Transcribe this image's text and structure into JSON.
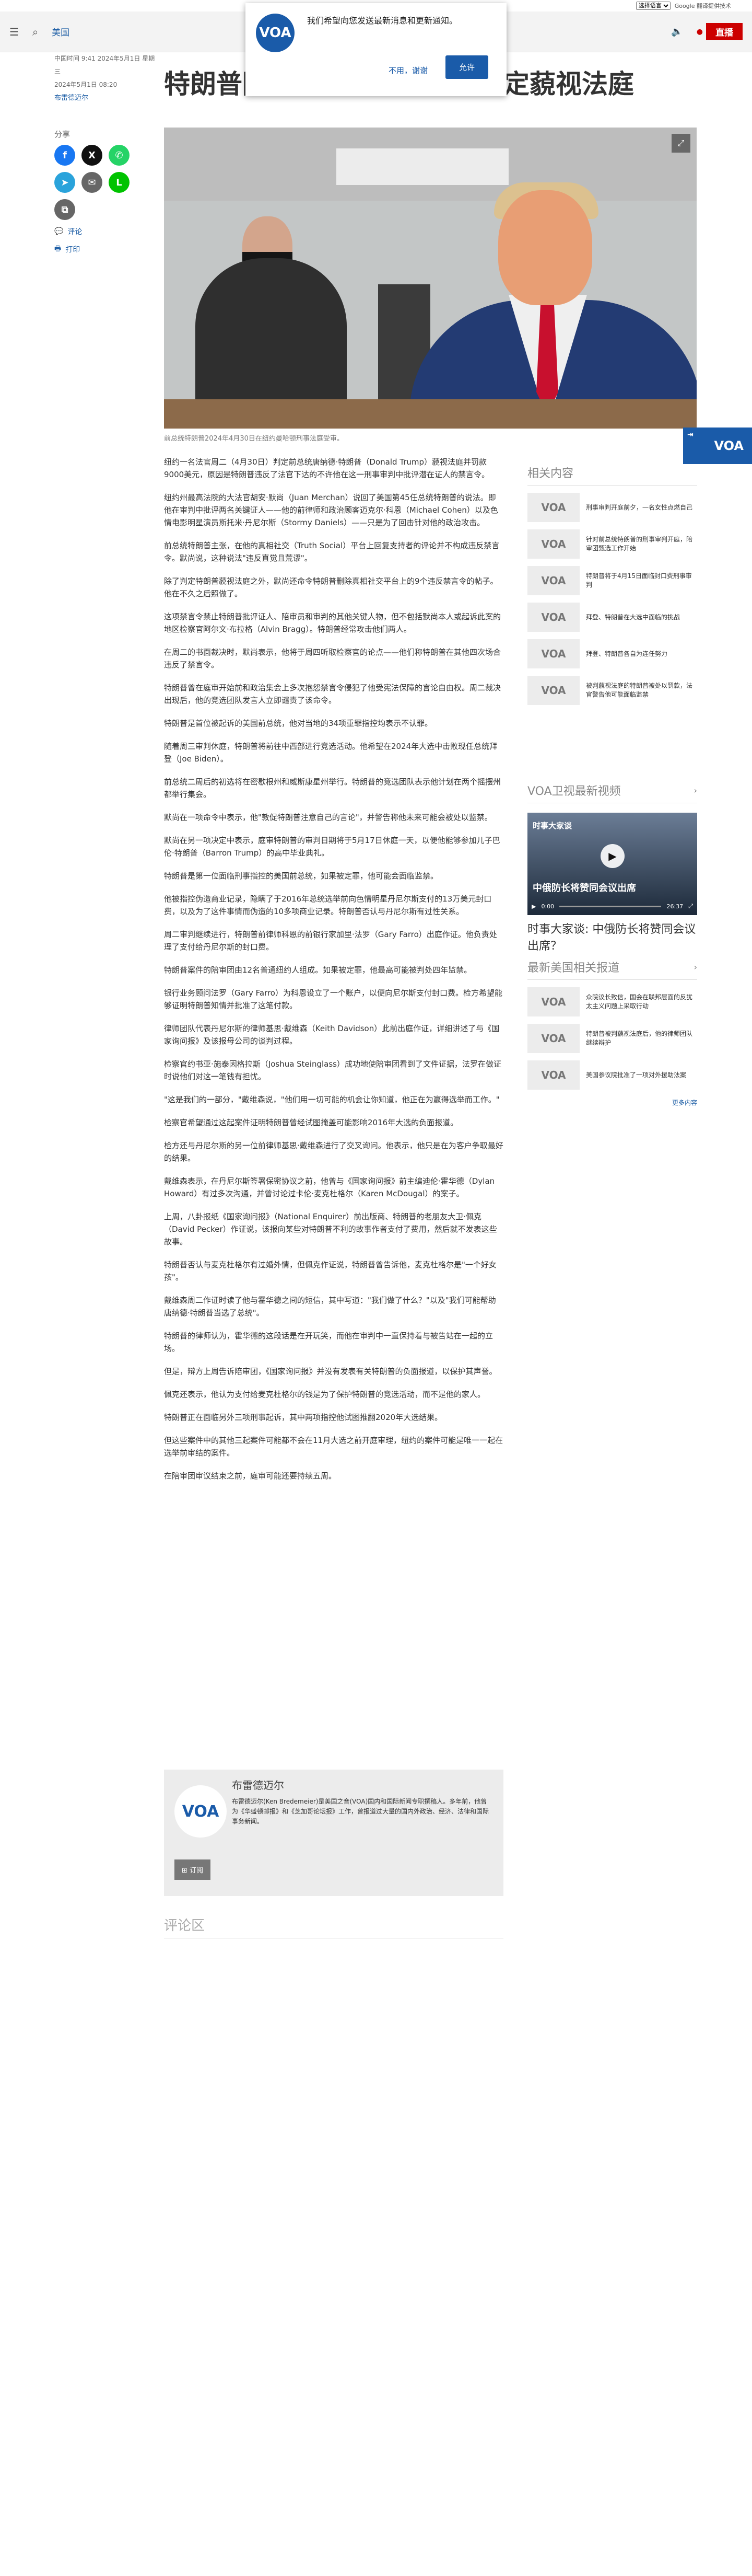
{
  "topbar": {
    "language": "选择语言",
    "translate": "Google 翻译提供技术"
  },
  "header": {
    "site": "美国",
    "live_label": "直播",
    "live_dot": "●"
  },
  "popup": {
    "logo": "VOA",
    "message": "我们希望向您发送最新消息和更新通知。",
    "deny": "不用，谢谢",
    "allow": "允许"
  },
  "meta": {
    "updated": "中国时间 9:41 2024年5月1日 星期三",
    "published": "2024年5月1日 08:20",
    "author": "布雷德迈尔"
  },
  "share": {
    "label": "分享",
    "comments": "评论",
    "print": "打印"
  },
  "article": {
    "title": "特朗普因违反禁言令被法官判定藐视法庭",
    "caption": "前总统特朗普2024年4月30日在纽约曼哈顿刑事法庭受审。",
    "paragraphs": [
      "纽约一名法官周二（4月30日）判定前总统唐纳德·特朗普（Donald Trump）藐视法庭并罚款9000美元，原因是特朗普违反了法官下达的不许他在这一刑事审判中批评潜在证人的禁言令。",
      "纽约州最高法院的大法官胡安·默尚（Juan Merchan）说回了美国第45任总统特朗普的说法。即他在审判中批评两名关键证人——他的前律师和政治顾客迈克尔·科恩（Michael Cohen）以及色情电影明星演员斯托米·丹尼尔斯（Stormy Daniels）——只是为了回击针对他的政治攻击。",
      "前总统特朗普主张，在他的真相社交（Truth Social）平台上回复支持者的评论并不构成违反禁言令。默尚说，这种说法\"违反直觉且荒谬\"。",
      "除了判定特朗普藐视法庭之外，默尚还命令特朗普删除真相社交平台上的9个违反禁言令的帖子。他在不久之后照做了。",
      "这项禁言令禁止特朗普批评证人、陪审员和审判的其他关键人物，但不包括默尚本人或起诉此案的地区检察官阿尔文·布拉格（Alvin Bragg）。特朗普经常攻击他们两人。",
      "在周二的书面裁决时，默尚表示，他将于周四听取检察官的论点——他们称特朗普在其他四次场合违反了禁言令。",
      "特朗普曾在庭审开始前和政治集会上多次抱怨禁言令侵犯了他受宪法保障的言论自由权。周二裁决出现后，他的竞选团队发言人立即谴责了该命令。",
      "特朗普是首位被起诉的美国前总统，他对当地的34项重罪指控均表示不认罪。",
      "随着周三审判休庭，特朗普将前往中西部进行竞选活动。他希望在2024年大选中击败现任总统拜登（Joe Biden）。",
      "前总统二周后的初选将在密歇根州和威斯康星州举行。特朗普的竞选团队表示他计划在两个摇摆州都举行集会。",
      "默尚在一项命令中表示，他\"敦促特朗普注意自己的言论\"，并警告称他未来可能会被处以监禁。",
      "默尚在另一项决定中表示，庭审特朗普的审判日期将于5月17日休庭一天，以便他能够参加儿子巴伦·特朗普（Barron Trump）的高中毕业典礼。",
      "特朗普是第一位面临刑事指控的美国前总统，如果被定罪，他可能会面临监禁。",
      "他被指控伪造商业记录，隐瞒了于2016年总统选举前向色情明星丹尼尔斯支付的13万美元封口费，以及为了这件事情而伪造的10多项商业记录。特朗普否认与丹尼尔斯有过性关系。",
      "周二审判继续进行，特朗普前律师科恩的前银行家加里·法罗（Gary Farro）出庭作证。他负责处理了支付给丹尼尔斯的封口费。",
      "特朗普案件的陪审团由12名普通纽约人组成。如果被定罪，他最高可能被判处四年监禁。",
      "银行业务顾问法罗（Gary Farro）为科恩设立了一个账户，以便向尼尔斯支付封口费。检方希望能够证明特朗普知情并批准了这笔付款。",
      "律师团队代表丹尼尔斯的律师基思·戴维森（Keith Davidson）此前出庭作证，详细讲述了与《国家询问报》及该报母公司的谈判过程。",
      "检察官约书亚·施泰因格拉斯（Joshua Steinglass）成功地使陪审团看到了文件证据，法罗在做证时说他们对这一笔钱有担忧。",
      "\"这是我们的一部分，\"戴维森说，\"他们用一切可能的机会让你知道，他正在为赢得选举而工作。\"",
      "检察官希望通过这起案件证明特朗普曾经试图掩盖可能影响2016年大选的负面报道。",
      "检方还与丹尼尔斯的另一位前律师基思·戴维森进行了交叉询问。他表示，他只是在为客户争取最好的结果。",
      "戴维森表示，在丹尼尔斯签署保密协议之前，他曾与《国家询问报》前主编迪伦·霍华德（Dylan Howard）有过多次沟通，并曾讨论过卡伦·麦克杜格尔（Karen McDougal）的案子。",
      "上周，八卦报纸《国家询问报》（National Enquirer）前出版商、特朗普的老朋友大卫·佩克（David Pecker）作证说，该报向某些对特朗普不利的故事作者支付了费用，然后就不发表这些故事。",
      "特朗普否认与麦克杜格尔有过婚外情，但佩克作证说，特朗普曾告诉他，麦克杜格尔是\"一个好女孩\"。",
      "戴维森周二作证时读了他与霍华德之间的短信，其中写道：\"我们做了什么？\"以及\"我们可能帮助唐纳德·特朗普当选了总统\"。",
      "特朗普的律师认为，霍华德的这段话是在开玩笑，而他在审判中一直保持着与被告站在一起的立场。",
      "但是，辩方上周告诉陪审团，《国家询问报》并没有发表有关特朗普的负面报道，以保护其声誉。",
      "佩克还表示，他认为支付给麦克杜格尔的钱是为了保护特朗普的竞选活动，而不是他的家人。",
      "特朗普正在面临另外三项刑事起诉，其中两项指控他试图推翻2020年大选结果。",
      "但这些案件中的其他三起案件可能都不会在11月大选之前开庭审理，纽约的案件可能是唯一一起在选举前审结的案件。",
      "在陪审团审议结束之前，庭审可能还要持续五周。"
    ]
  },
  "author_box": {
    "logo": "VOA",
    "name": "布雷德迈尔",
    "bio": "布雷德迈尔(Ken Bredemeier)是美国之音(VOA)国内和国际新闻专职撰稿人。多年前，他曾为《华盛顿邮报》和《芝加哥论坛报》工作，曾报道过大量的国内外政治、经济、法律和国际事务新闻。",
    "subscribe": "订阅"
  },
  "comments": {
    "heading": "评论区"
  },
  "sidebar": {
    "related_heading": "相关内容",
    "related": [
      {
        "logo": "VOA",
        "title": "刑事审判开庭前夕，一名女性点燃自己"
      },
      {
        "logo": "VOA",
        "title": "针对前总统特朗普的刑事审判开庭，陪审团甄选工作开始"
      },
      {
        "logo": "VOA",
        "title": "特朗普将于4月15日面临封口费刑事审判"
      },
      {
        "logo": "VOA",
        "title": "拜登、特朗普在大选中面临的挑战"
      },
      {
        "logo": "VOA",
        "title": "拜登、特朗普各自为连任努力"
      },
      {
        "logo": "VOA",
        "title": "被判藐视法庭的特朗普被处以罚款，法官警告他可能面临监禁"
      }
    ],
    "video_heading": "VOA卫视最新视频",
    "video": {
      "overlay_top": "时事大家谈",
      "overlay_big": "中俄防长将赞同会议出席",
      "time_now": "0:00",
      "time_total": "26:37",
      "title": "时事大家谈: 中俄防长将赞同会议出席？"
    },
    "latest_heading": "最新美国相关报道",
    "latest": [
      {
        "logo": "VOA",
        "title": "众院议长致信，国会在联邦层面的反犹太主义问题上采取行动"
      },
      {
        "logo": "VOA",
        "title": "特朗普被判藐视法庭后，他的律师团队继续辩护"
      },
      {
        "logo": "VOA",
        "title": "美国参议院批准了一项对外援助法案"
      }
    ],
    "more": "更多内容"
  },
  "float": {
    "logo": "VOA"
  }
}
